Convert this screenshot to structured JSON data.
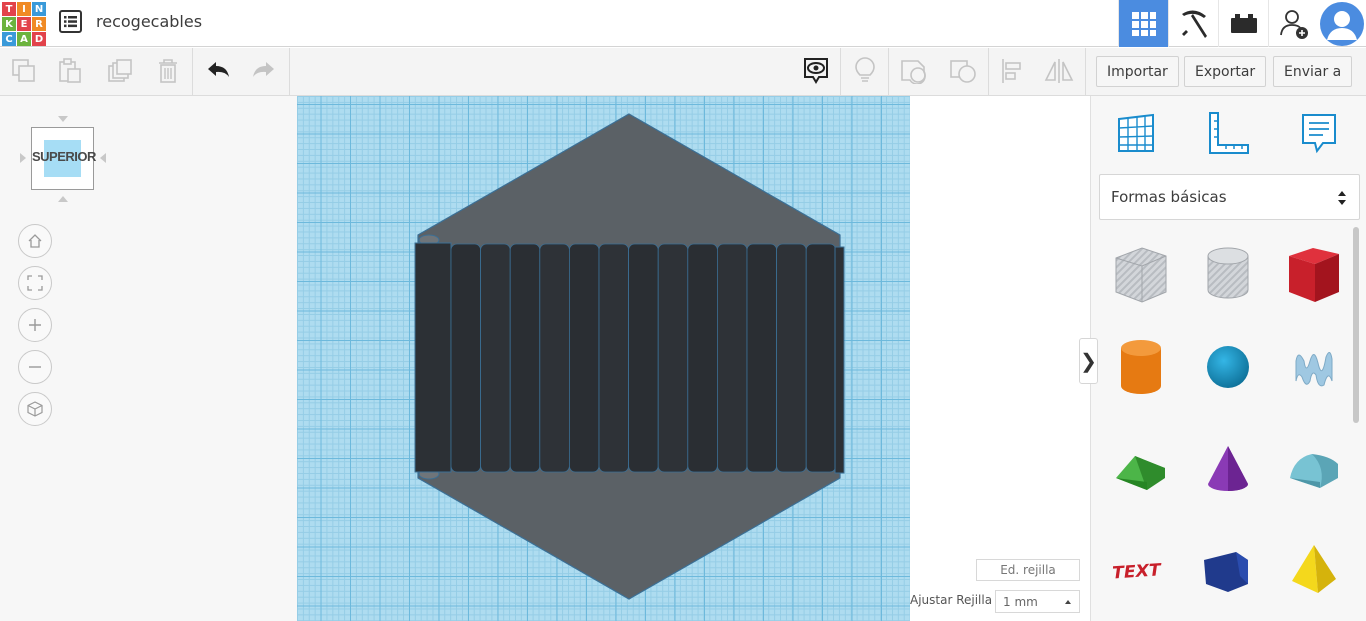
{
  "app": {
    "logo_letters": [
      "T",
      "I",
      "N",
      "K",
      "E",
      "R",
      "C",
      "A",
      "D"
    ],
    "design_title": "recogecables"
  },
  "topbar_right": {
    "items": [
      "grid-view-icon",
      "pickaxe-icon",
      "bricks-icon",
      "add-user-icon",
      "user-avatar"
    ]
  },
  "toolbar": {
    "import_label": "Importar",
    "export_label": "Exportar",
    "send_label": "Enviar a"
  },
  "viewcube": {
    "face_label": "SUPERIOR"
  },
  "workplane": {
    "edit_grid_label": "Ed. rejilla",
    "snap_grid_label": "Ajustar Rejilla",
    "snap_grid_value": "1 mm"
  },
  "shapes_panel": {
    "category_value": "Formas básicas",
    "items": [
      "box-hole",
      "cylinder-hole",
      "box",
      "cylinder",
      "sphere",
      "scribble",
      "roof",
      "cone",
      "round-roof",
      "text",
      "prism",
      "pyramid"
    ]
  },
  "colors": {
    "accent": "#4b8ce0",
    "workplane": "#aedcf0",
    "object_dark": "#2e3237",
    "object_gray": "#5c6166"
  }
}
